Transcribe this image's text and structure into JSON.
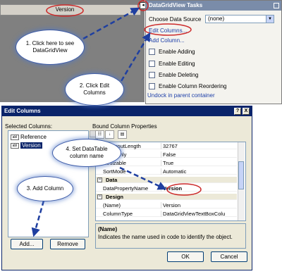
{
  "designer": {
    "column_header": "Version",
    "smart_tag_glyph": "◂"
  },
  "tasks_panel": {
    "title": "DataGridView Tasks",
    "choose_label": "Choose Data Source",
    "choose_value": "(none)",
    "edit_columns": "Edit Columns...",
    "add_column": "Add Column...",
    "checkboxes": [
      {
        "label": "Enable Adding"
      },
      {
        "label": "Enable Editing"
      },
      {
        "label": "Enable Deleting"
      },
      {
        "label": "Enable Column Reordering"
      }
    ],
    "undock": "Undock in parent container"
  },
  "dialog": {
    "title": "Edit Columns",
    "help_btn": "?",
    "close_btn": "X",
    "selected_label": "Selected Columns:",
    "columns": [
      {
        "icon": "abl",
        "label": "Reference",
        "selected": false
      },
      {
        "icon": "abl",
        "label": "Version",
        "selected": true
      }
    ],
    "add_btn": "Add...",
    "remove_btn": "Remove",
    "bound_label": "Bound Column Properties",
    "properties": [
      {
        "kind": "prop",
        "name": "MaxInputLength",
        "value": "32767"
      },
      {
        "kind": "prop",
        "name": "ReadOnly",
        "value": "False"
      },
      {
        "kind": "prop",
        "name": "Resizable",
        "value": "True"
      },
      {
        "kind": "prop",
        "name": "SortMode",
        "value": "Automatic"
      },
      {
        "kind": "cat",
        "name": "Data",
        "toggle": "−"
      },
      {
        "kind": "prop",
        "name": "DataPropertyName",
        "value": "Version",
        "bold": true
      },
      {
        "kind": "cat",
        "name": "Design",
        "toggle": "−"
      },
      {
        "kind": "prop",
        "name": "(Name)",
        "value": "Version"
      },
      {
        "kind": "prop",
        "name": "ColumnType",
        "value": "DataGridViewTextBoxColu"
      }
    ],
    "help_title": "(Name)",
    "help_desc": "Indicates the name used in code to identify the object.",
    "ok_btn": "OK",
    "cancel_btn": "Cancel"
  },
  "callouts": {
    "c1": "1. Click here to see DataGridView",
    "c2": "2. Click Edit Columns",
    "c3": "3. Add Column",
    "c4": "4. Set DataTable column name"
  },
  "colors": {
    "annotation_red": "#cc2a2a",
    "arrow_blue": "#1f3fa0",
    "title_bar": "#0a246a",
    "tasks_title": "#7a8ca9"
  }
}
